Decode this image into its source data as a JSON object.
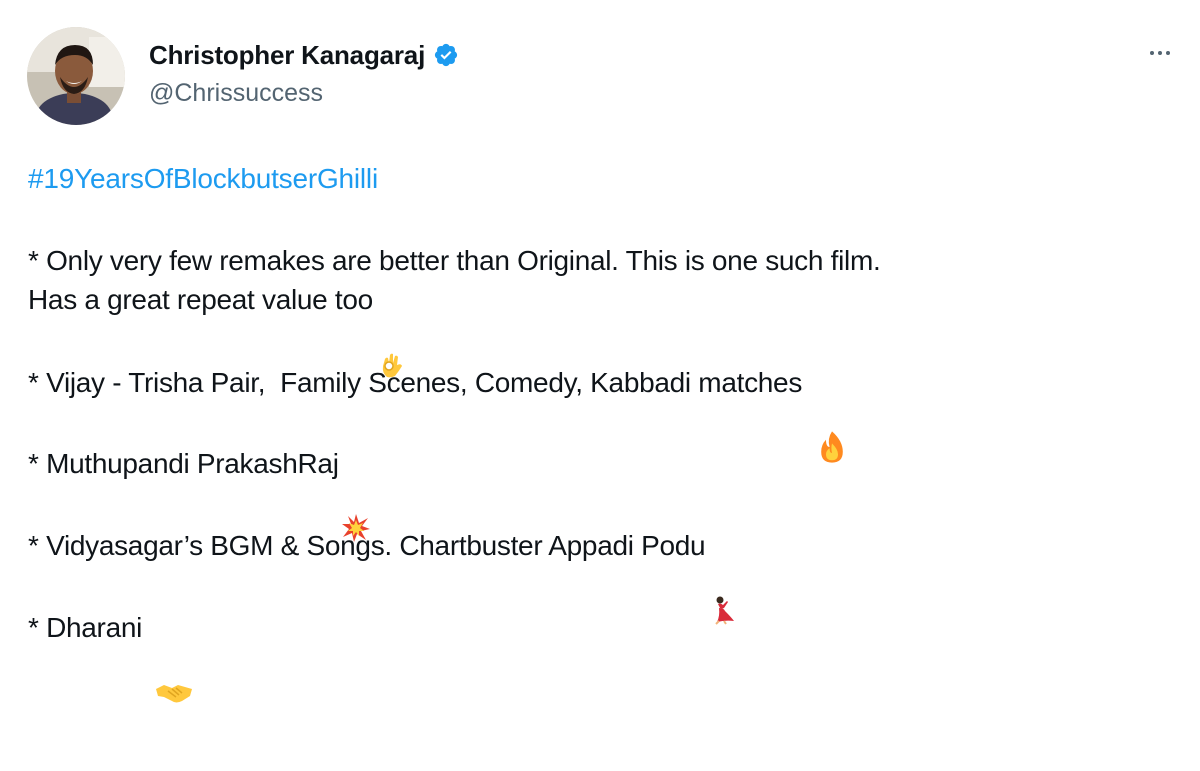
{
  "author": {
    "display_name": "Christopher Kanagaraj",
    "handle": "@Chrissuccess",
    "verified": true,
    "verified_color": "#1d9bf0"
  },
  "tweet": {
    "hashtag": "#19YearsOfBlockbutserGhilli",
    "lines": [
      {
        "text": "* Only very few remakes are better than Original. This is one such film.",
        "emoji": ""
      },
      {
        "text": "Has a great repeat value too",
        "emoji": "ok-hand-emoji"
      },
      {
        "text": "* Vijay - Trisha Pair,  Family Scenes, Comedy, Kabbadi matches ",
        "emoji": "fire-emoji"
      },
      {
        "text": "* Muthupandi PrakashRaj",
        "emoji": "collision-emoji"
      },
      {
        "text": "* Vidyasagar’s BGM & Songs. Chartbuster Appadi Podu",
        "emoji": "dancer-emoji"
      },
      {
        "text": "* Dharani ",
        "emoji": "handshake-emoji"
      }
    ]
  },
  "colors": {
    "text": "#0f1419",
    "secondary": "#536471",
    "link": "#1d9bf0"
  },
  "icons": {
    "more": "more-horizontal-icon",
    "verified": "verified-badge-icon"
  }
}
